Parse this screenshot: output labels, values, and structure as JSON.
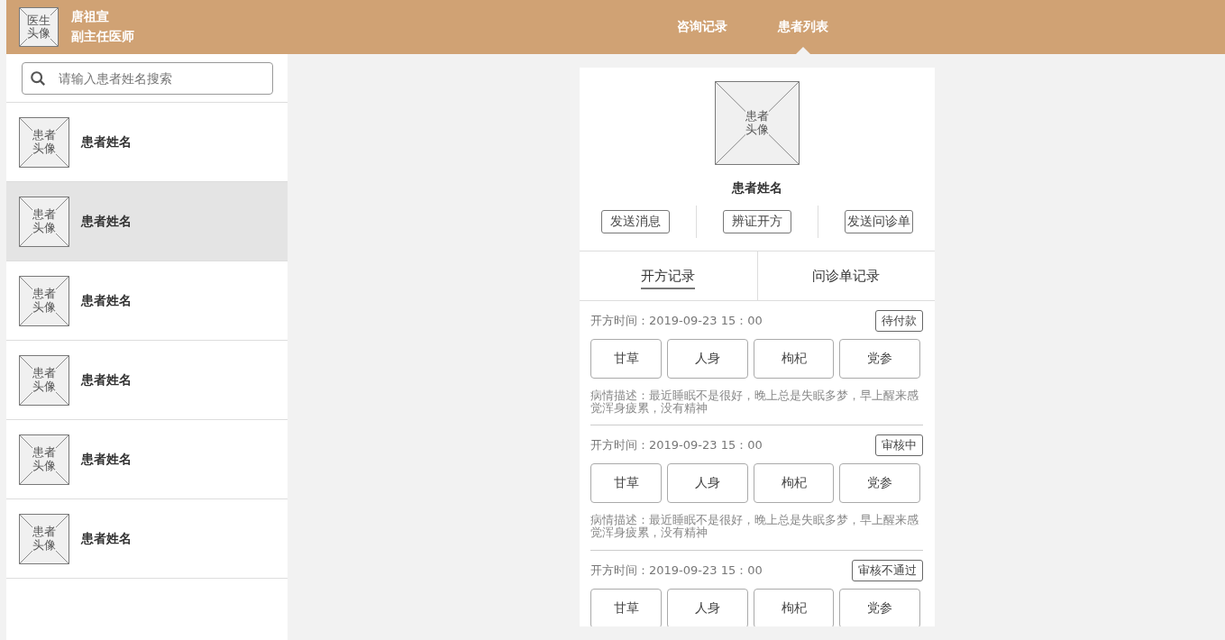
{
  "doctor": {
    "avatar_label": "医生头像",
    "name": "唐祖宣",
    "title": "副主任医师"
  },
  "nav_tabs": [
    {
      "label": "咨询记录",
      "selected": false
    },
    {
      "label": "患者列表",
      "selected": true
    }
  ],
  "search": {
    "placeholder": "请输入患者姓名搜索"
  },
  "patients": [
    {
      "avatar_label": "患者头像",
      "name": "患者姓名",
      "selected": false
    },
    {
      "avatar_label": "患者头像",
      "name": "患者姓名",
      "selected": true
    },
    {
      "avatar_label": "患者头像",
      "name": "患者姓名",
      "selected": false
    },
    {
      "avatar_label": "患者头像",
      "name": "患者姓名",
      "selected": false
    },
    {
      "avatar_label": "患者头像",
      "name": "患者姓名",
      "selected": false
    },
    {
      "avatar_label": "患者头像",
      "name": "患者姓名",
      "selected": false
    }
  ],
  "profile": {
    "avatar_label": "患者头像",
    "name": "患者姓名",
    "actions": [
      "发送消息",
      "辨证开方",
      "发送问诊单"
    ]
  },
  "record_tabs": [
    {
      "label": "开方记录",
      "selected": true
    },
    {
      "label": "问诊单记录",
      "selected": false
    }
  ],
  "records": [
    {
      "time": "开方时间：2019-09-23  15：00",
      "status": "待付款",
      "herbs": [
        "甘草",
        "人身",
        "枸杞",
        "党参"
      ],
      "description": "病情描述：最近睡眠不是很好，晚上总是失眠多梦，早上醒来感觉浑身疲累，没有精神"
    },
    {
      "time": "开方时间：2019-09-23  15：00",
      "status": "审核中",
      "herbs": [
        "甘草",
        "人身",
        "枸杞",
        "党参"
      ],
      "description": "病情描述：最近睡眠不是很好，晚上总是失眠多梦，早上醒来感觉浑身疲累，没有精神"
    },
    {
      "time": "开方时间：2019-09-23  15：00",
      "status": "审核不通过",
      "herbs": [
        "甘草",
        "人身",
        "枸杞",
        "党参"
      ]
    }
  ]
}
